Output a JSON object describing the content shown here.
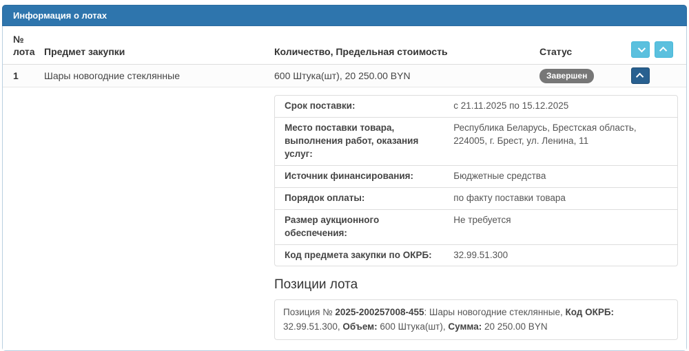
{
  "panel": {
    "title": "Информация о лотах",
    "colors": {
      "header_bg": "#2e75ad",
      "panel_border": "#b9cfe0",
      "info_button_bg": "#5bc0de",
      "collapse_button_bg": "#286090",
      "badge_bg": "#777777"
    }
  },
  "table": {
    "headers": {
      "lot_number": "№ лота",
      "subject": "Предмет закупки",
      "quantity": "Количество, Предельная стоимость",
      "status": "Статус"
    }
  },
  "lot": {
    "number": "1",
    "subject": "Шары новогодние стеклянные",
    "quantity": "600 Штука(шт), 20 250.00 BYN",
    "status": "Завершен"
  },
  "details": {
    "rows": [
      {
        "label": "Срок поставки:",
        "value": "с 21.11.2025 по 15.12.2025"
      },
      {
        "label": "Место поставки товара, выполнения работ, оказания услуг:",
        "value": "Республика Беларусь, Брестская область, 224005, г. Брест, ул. Ленина, 11"
      },
      {
        "label": "Источник финансирования:",
        "value": "Бюджетные средства"
      },
      {
        "label": "Порядок оплаты:",
        "value": "по факту поставки товара"
      },
      {
        "label": "Размер аукционного обеспечения:",
        "value": "Не требуется"
      },
      {
        "label": "Код предмета закупки по ОКРБ:",
        "value": "32.99.51.300"
      }
    ]
  },
  "positions": {
    "title": "Позиции лота",
    "item": {
      "prefix": "Позиция № ",
      "number": "2025-200257008-455",
      "name_part": ": Шары новогодние стеклянные, ",
      "okrb_label": "Код ОКРБ:",
      "okrb_value": " 32.99.51.300, ",
      "volume_label": "Объем:",
      "volume_value": " 600 Штука(шт), ",
      "sum_label": "Сумма:",
      "sum_value": " 20 250.00 BYN"
    }
  }
}
